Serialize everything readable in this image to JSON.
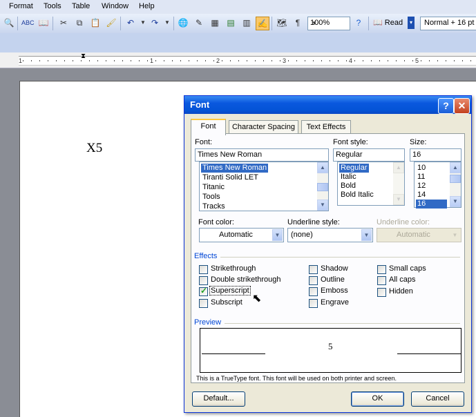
{
  "menubar": {
    "items": [
      "Format",
      "Tools",
      "Table",
      "Window",
      "Help"
    ]
  },
  "toolbar": {
    "zoom": "100%",
    "read_label": "Read",
    "style_value": "Normal + 16 pt"
  },
  "ruler": {
    "numbers": [
      "1",
      "1",
      "2",
      "3",
      "4",
      "5"
    ]
  },
  "document": {
    "text": "X5"
  },
  "dialog": {
    "title": "Font",
    "help_label": "?",
    "close_label": "✕",
    "tabs": [
      "Font",
      "Character Spacing",
      "Text Effects"
    ],
    "font": {
      "label": "Font:",
      "value": "Times New Roman",
      "items": [
        "Times New Roman",
        "Tiranti Solid LET",
        "Titanic",
        "Tools",
        "Tracks"
      ]
    },
    "font_style": {
      "label": "Font style:",
      "value": "Regular",
      "items": [
        "Regular",
        "Italic",
        "Bold",
        "Bold Italic"
      ]
    },
    "size": {
      "label": "Size:",
      "value": "16",
      "items": [
        "10",
        "11",
        "12",
        "14",
        "16"
      ]
    },
    "font_color": {
      "label": "Font color:",
      "value": "Automatic"
    },
    "underline_style": {
      "label": "Underline style:",
      "value": "(none)"
    },
    "underline_color": {
      "label": "Underline color:",
      "value": "Automatic"
    },
    "effects": {
      "title": "Effects",
      "col1": [
        {
          "label": "Strikethrough",
          "checked": false
        },
        {
          "label": "Double strikethrough",
          "checked": false
        },
        {
          "label": "Superscript",
          "checked": true
        },
        {
          "label": "Subscript",
          "checked": false
        }
      ],
      "col2": [
        {
          "label": "Shadow",
          "checked": false
        },
        {
          "label": "Outline",
          "checked": false
        },
        {
          "label": "Emboss",
          "checked": false
        },
        {
          "label": "Engrave",
          "checked": false
        }
      ],
      "col3": [
        {
          "label": "Small caps",
          "checked": false
        },
        {
          "label": "All caps",
          "checked": false
        },
        {
          "label": "Hidden",
          "checked": false
        }
      ]
    },
    "preview": {
      "title": "Preview",
      "text": "5"
    },
    "note": "This is a TrueType font. This font will be used on both printer and screen.",
    "buttons": {
      "default": "Default...",
      "ok": "OK",
      "cancel": "Cancel"
    }
  }
}
